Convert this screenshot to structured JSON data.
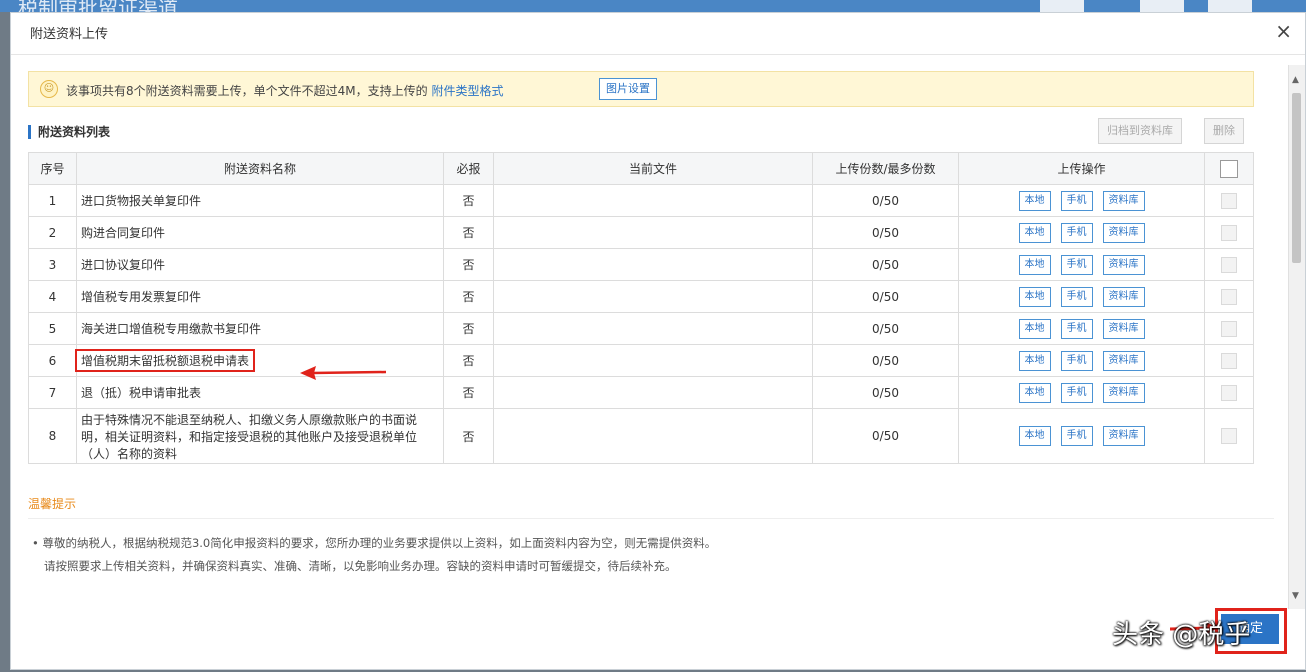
{
  "background": {
    "header_text": "税制审批留证渠道"
  },
  "dialog": {
    "title": "附送资料上传",
    "close_glyph": "×"
  },
  "notice": {
    "text": "该事项共有8个附送资料需要上传，单个文件不超过4M，支持上传的",
    "link": "附件类型格式",
    "button": "图片设置"
  },
  "list": {
    "title": "附送资料列表",
    "buttons": {
      "attachment_library": "归档到资料库",
      "delete": "删除"
    },
    "headers": {
      "index": "序号",
      "name": "附送资料名称",
      "required": "必报",
      "current_file": "当前文件",
      "count": "上传份数/最多份数",
      "ops": "上传操作"
    },
    "op_labels": {
      "local": "本地",
      "phone": "手机",
      "library": "资料库"
    },
    "rows": [
      {
        "index": "1",
        "name": "进口货物报关单复印件",
        "required": "否",
        "current_file": "",
        "count": "0/50"
      },
      {
        "index": "2",
        "name": "购进合同复印件",
        "required": "否",
        "current_file": "",
        "count": "0/50"
      },
      {
        "index": "3",
        "name": "进口协议复印件",
        "required": "否",
        "current_file": "",
        "count": "0/50"
      },
      {
        "index": "4",
        "name": "增值税专用发票复印件",
        "required": "否",
        "current_file": "",
        "count": "0/50"
      },
      {
        "index": "5",
        "name": "海关进口增值税专用缴款书复印件",
        "required": "否",
        "current_file": "",
        "count": "0/50"
      },
      {
        "index": "6",
        "name": "增值税期末留抵税额退税申请表",
        "required": "否",
        "current_file": "",
        "count": "0/50"
      },
      {
        "index": "7",
        "name": "退（抵）税申请审批表",
        "required": "否",
        "current_file": "",
        "count": "0/50"
      },
      {
        "index": "8",
        "name": "由于特殊情况不能退至纳税人、扣缴义务人原缴款账户的书面说明，相关证明资料，和指定接受退税的其他账户及接受退税单位（人）名称的资料",
        "required": "否",
        "current_file": "",
        "count": "0/50"
      }
    ]
  },
  "tips": {
    "title": "温馨提示",
    "line1": "尊敬的纳税人，根据纳税规范3.0简化申报资料的要求，您所办理的业务要求提供以上资料，如上面资料内容为空，则无需提供资料。",
    "line2": "请按照要求上传相关资料，并确保资料真实、准确、清晰，以免影响业务办理。容缺的资料申请时可暂缓提交，待后续补充。"
  },
  "footer": {
    "confirm": "确定"
  },
  "watermark": "头条 @税乎",
  "colors": {
    "accent": "#2b74c6",
    "highlight_red": "#e0231b",
    "notice_bg": "#fff7d6",
    "tips_orange": "#e88a1a"
  }
}
